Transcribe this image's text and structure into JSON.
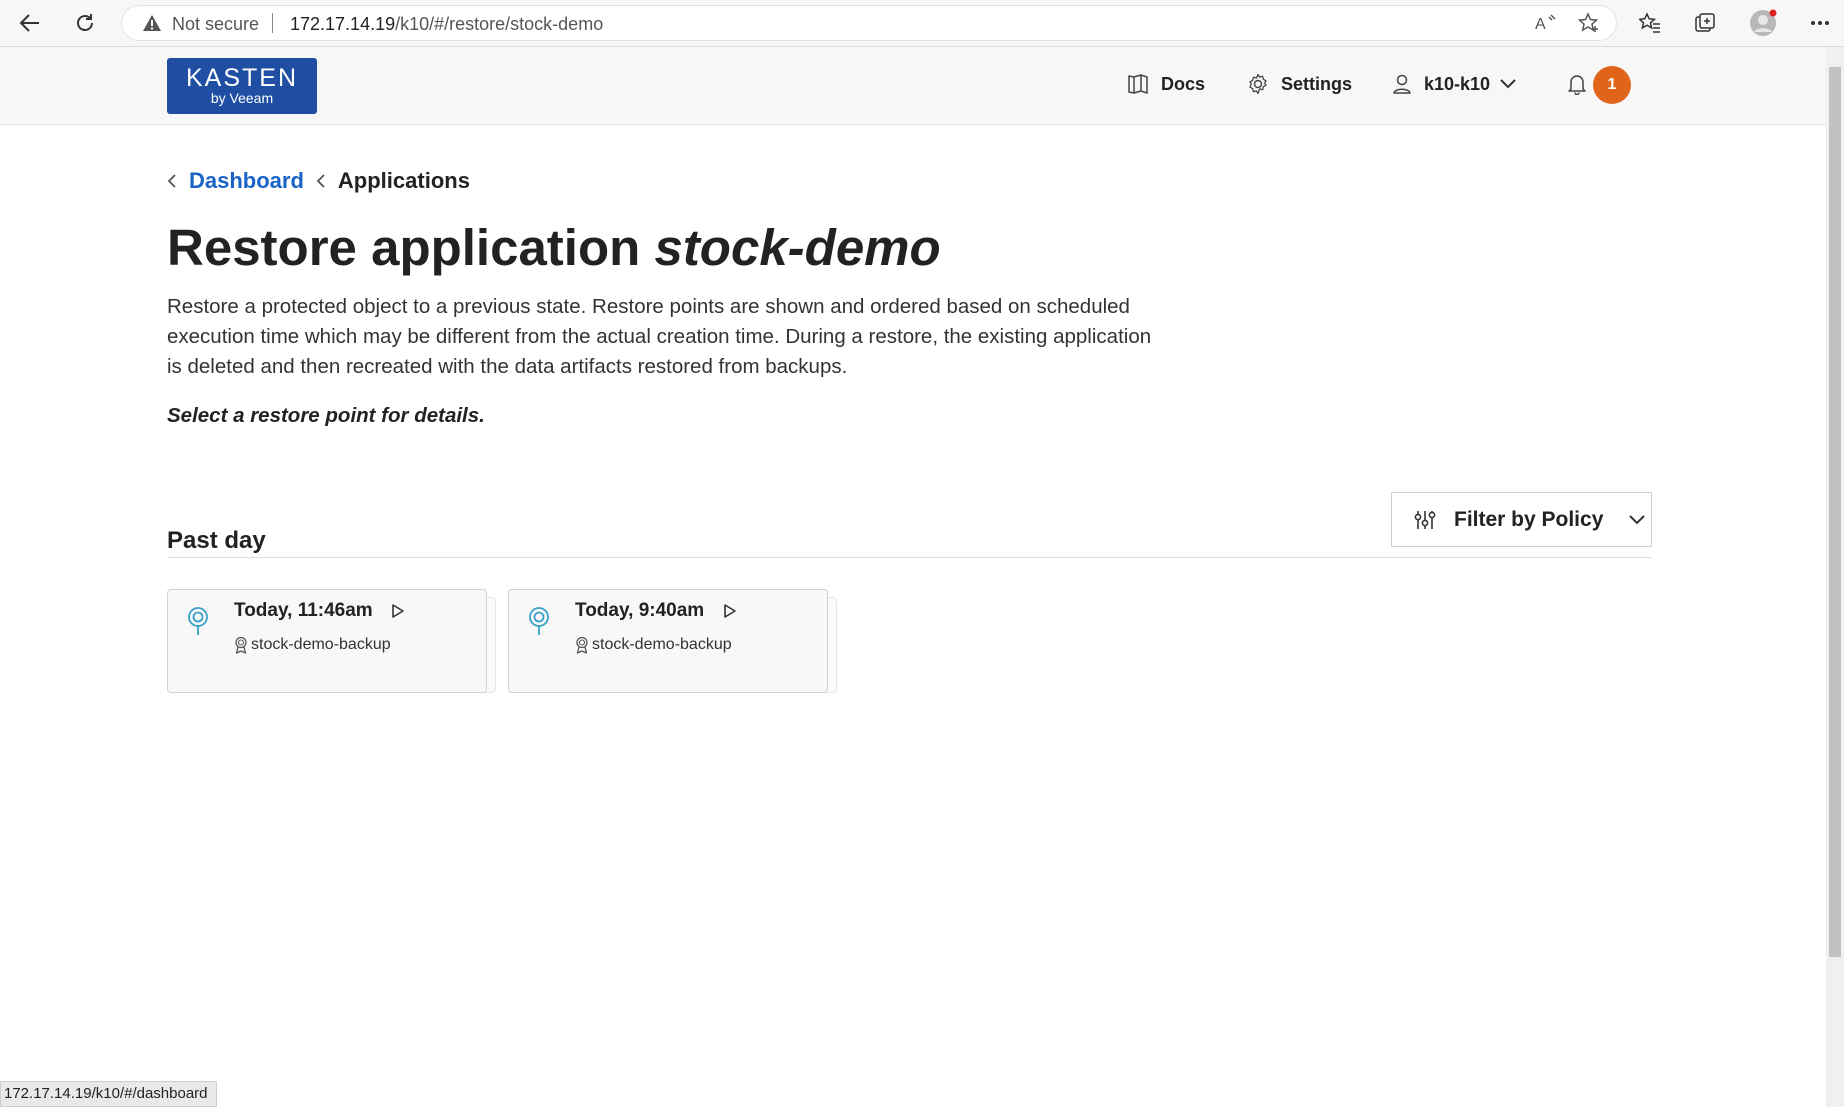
{
  "browser": {
    "security_label": "Not secure",
    "url_host": "172.17.14.19",
    "url_path": "/k10/#/restore/stock-demo"
  },
  "header": {
    "logo_line1": "KASTEN",
    "logo_line2": "by Veeam",
    "docs_label": "Docs",
    "settings_label": "Settings",
    "user_label": "k10-k10",
    "notification_count": "1"
  },
  "breadcrumb": {
    "dashboard": "Dashboard",
    "applications": "Applications"
  },
  "page": {
    "title_prefix": "Restore application ",
    "title_app": "stock-demo",
    "description": "Restore a protected object to a previous state. Restore points are shown and ordered based on scheduled execution time which may be different from the actual creation time. During a restore, the existing application is deleted and then recreated with the data artifacts restored from backups.",
    "hint": "Select a restore point for details."
  },
  "filter": {
    "label": "Filter by Policy"
  },
  "section": {
    "title": "Past day"
  },
  "restore_points": [
    {
      "time": "Today, 11:46am",
      "policy": "stock-demo-backup"
    },
    {
      "time": "Today, 9:40am",
      "policy": "stock-demo-backup"
    }
  ],
  "status_bar": {
    "url": "172.17.14.19/k10/#/dashboard"
  },
  "colors": {
    "brand": "#1f4ea3",
    "link": "#1a64c6",
    "badge": "#e0651b",
    "pin": "#3aa0c8"
  }
}
